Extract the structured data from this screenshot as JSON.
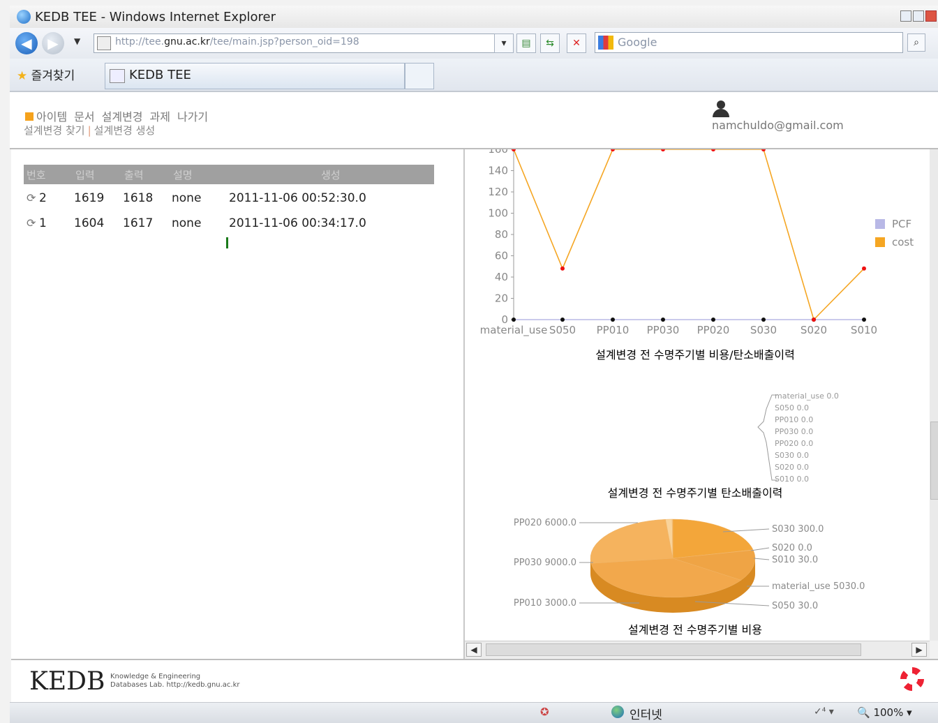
{
  "window": {
    "title": "KEDB TEE - Windows Internet Explorer"
  },
  "address_bar": {
    "url_prefix": "http://tee.",
    "url_domain": "gnu.ac.kr",
    "url_suffix": "/tee/main.jsp?person_oid=198",
    "search_placeholder": "Google",
    "search_glyph": "⌕"
  },
  "favorites": {
    "label": "즐겨찾기"
  },
  "tab": {
    "label": "KEDB TEE"
  },
  "app_menu": {
    "items": [
      "아이템",
      "문서",
      "설계변경",
      "과제",
      "나가기"
    ],
    "sub_items": [
      "설계변경 찾기",
      "설계변경 생성"
    ]
  },
  "user": {
    "email": "namchuldo@gmail.com"
  },
  "table": {
    "headers": [
      "번호",
      "입력",
      "출력",
      "설명",
      "생성"
    ],
    "rows": [
      {
        "num": "2",
        "input": "1619",
        "output": "1618",
        "desc": "none",
        "created": "2011-11-06 00:52:30.0"
      },
      {
        "num": "1",
        "input": "1604",
        "output": "1617",
        "desc": "none",
        "created": "2011-11-06 00:34:17.0"
      }
    ]
  },
  "chart_data": [
    {
      "type": "line",
      "title": "설계변경 전 수명주기별 비용/탄소배출이력",
      "categories": [
        "material_use",
        "S050",
        "PP010",
        "PP030",
        "PP020",
        "S030",
        "S020",
        "S010"
      ],
      "y_ticks": [
        "0",
        "20",
        "40",
        "60",
        "80",
        "100",
        "120",
        "140",
        "160"
      ],
      "ylim": [
        0,
        160
      ],
      "grid": false,
      "legend_position": "right",
      "series": [
        {
          "name": "PCF",
          "color": "#b8b8e6",
          "values": [
            0,
            0,
            0,
            0,
            0,
            0,
            0,
            0
          ]
        },
        {
          "name": "cost",
          "color": "#f5a623",
          "values": [
            160,
            48,
            160,
            160,
            160,
            160,
            0,
            48
          ]
        }
      ]
    },
    {
      "type": "pie",
      "title": "설계변경 전 수명주기별 탄소배출이력",
      "labels": [
        "material_use 0.0",
        "S050 0.0",
        "PP010 0.0",
        "PP030 0.0",
        "PP020 0.0",
        "S030 0.0",
        "S020 0.0",
        "S010 0.0"
      ],
      "categories": [
        "material_use",
        "S050",
        "PP010",
        "PP030",
        "PP020",
        "S030",
        "S020",
        "S010"
      ],
      "values": [
        0,
        0,
        0,
        0,
        0,
        0,
        0,
        0
      ]
    },
    {
      "type": "pie",
      "title": "설계변경 전 수명주기별 비용",
      "categories": [
        "material_use",
        "S050",
        "PP010",
        "PP030",
        "PP020",
        "S030",
        "S020",
        "S010"
      ],
      "values": [
        5030,
        30,
        3000,
        9000,
        6000,
        300,
        0,
        30
      ],
      "labels": [
        "material_use 5030.0",
        "S050 30.0",
        "PP010 3000.0",
        "PP030 9000.0",
        "PP020 6000.0",
        "S030 300.0",
        "S020 0.0",
        "S010 30.0"
      ]
    }
  ],
  "footer": {
    "logo": "KEDB",
    "subtitle_line1": "Knowledge & Engineering",
    "subtitle_line2": "Databases Lab. http://kedb.gnu.ac.kr"
  },
  "status_bar": {
    "zone": "인터넷",
    "security": "✓⁴ ▾",
    "zoom": "100%"
  }
}
